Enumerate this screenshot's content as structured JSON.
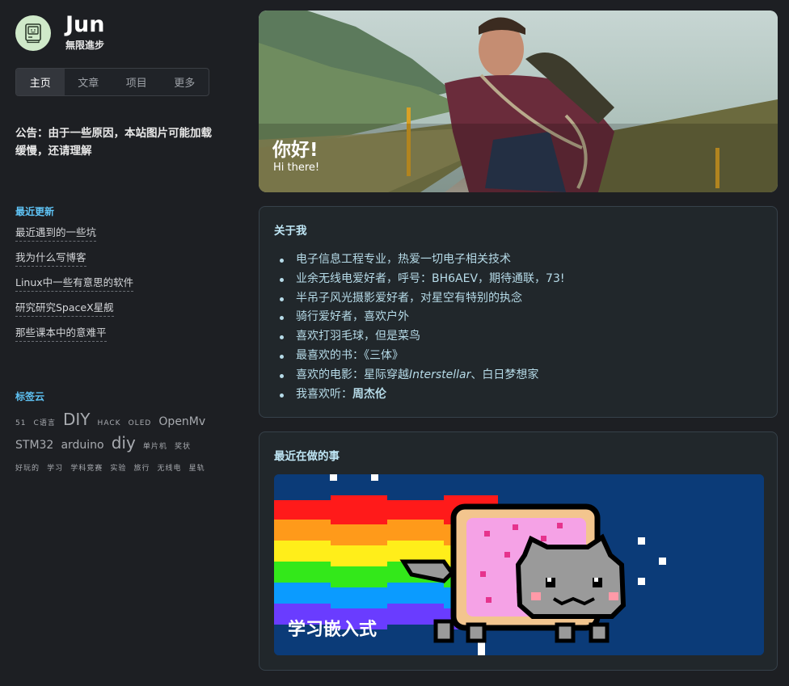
{
  "site": {
    "name": "Jun",
    "subtitle": "無限進步"
  },
  "nav": {
    "items": [
      "主页",
      "文章",
      "项目",
      "更多"
    ],
    "active": 0
  },
  "notice": "公告：由于一些原因，本站图片可能加载缓慢，还请理解",
  "recent": {
    "title": "最近更新",
    "items": [
      "最近遇到的一些坑",
      "我为什么写博客",
      "Linux中一些有意思的软件",
      "研究研究SpaceX星舰",
      "那些课本中的意难平"
    ]
  },
  "tags": {
    "title": "标签云",
    "items": [
      "51",
      "C语言",
      "DIY",
      "HACK",
      "OLED",
      "OpenMv",
      "STM32",
      "arduino",
      "diy",
      "单片机",
      "奖状",
      "好玩的",
      "学习",
      "学科竞赛",
      "实验",
      "旅行",
      "无线电",
      "星轨"
    ]
  },
  "hero": {
    "title": "你好!",
    "subtitle": "Hi there!"
  },
  "about": {
    "title": "关于我",
    "items": [
      "电子信息工程专业，热爱一切电子相关技术",
      "业余无线电爱好者，呼号：BH6AEV，期待通联，73!",
      "半吊子风光摄影爱好者，对星空有特别的执念",
      "骑行爱好者，喜欢户外",
      "喜欢打羽毛球，但是菜鸟",
      "最喜欢的书：《三体》"
    ],
    "movie": {
      "prefix": "喜欢的电影：星际穿越",
      "italic": "Interstellar",
      "suffix": "、白日梦想家"
    },
    "music": {
      "prefix": "我喜欢听：",
      "bold": "周杰伦"
    }
  },
  "doing": {
    "title": "最近在做的事",
    "caption": "学习嵌入式"
  },
  "colors": {
    "background": "#1d1f23",
    "accent": "#5fc3f5",
    "card": "#21272b",
    "card_text": "#b6dbe8"
  }
}
